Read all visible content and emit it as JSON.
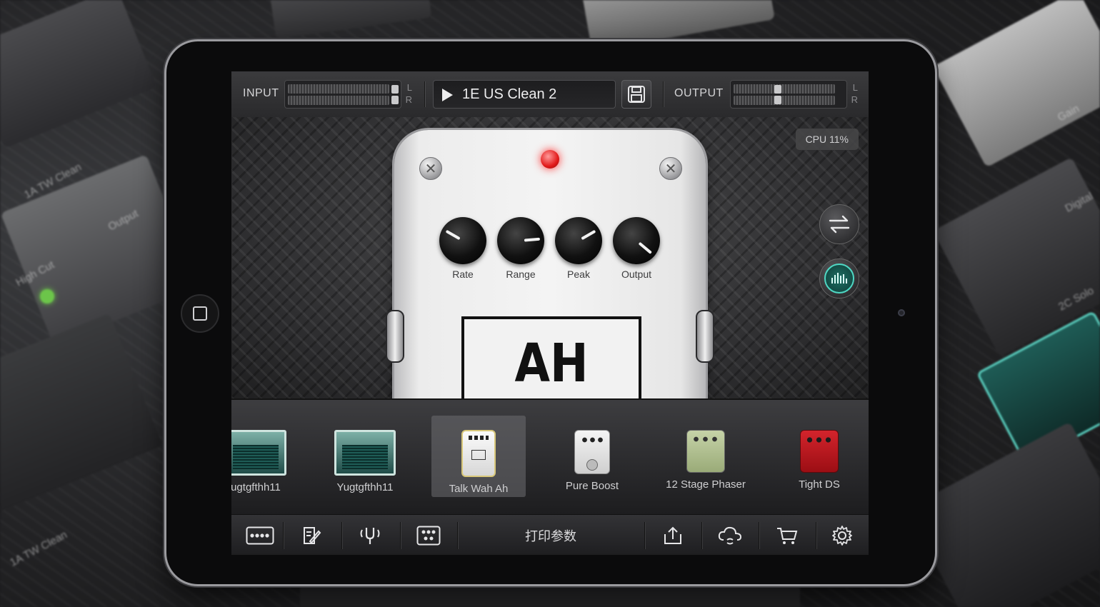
{
  "header": {
    "input_label": "INPUT",
    "output_label": "OUTPUT",
    "channel_l": "L",
    "channel_r": "R",
    "preset_name": "1E US Clean 2"
  },
  "status": {
    "cpu": "CPU 11%"
  },
  "pedal": {
    "label": "AH",
    "knobs": [
      {
        "label": "Rate"
      },
      {
        "label": "Range"
      },
      {
        "label": "Peak"
      },
      {
        "label": "Output"
      }
    ]
  },
  "effects": [
    {
      "label": "ugtgfthh11"
    },
    {
      "label": "Yugtgfthh11"
    },
    {
      "label": "Talk Wah Ah",
      "selected": true
    },
    {
      "label": "Pure Boost"
    },
    {
      "label": "12 Stage Phaser"
    },
    {
      "label": "Tight DS"
    }
  ],
  "toolbar": {
    "center_text": "打印参数"
  },
  "background_labels": [
    "1A TW Clean",
    "High Cut",
    "Output",
    "1A TW Clean",
    "Gain",
    "2C Solo",
    "Digital"
  ],
  "colors": {
    "led": "#e21a1a",
    "accent_teal": "#4fd8c4",
    "tight_ds_red": "#c8141c",
    "phaser_green": "#b9c89b"
  }
}
